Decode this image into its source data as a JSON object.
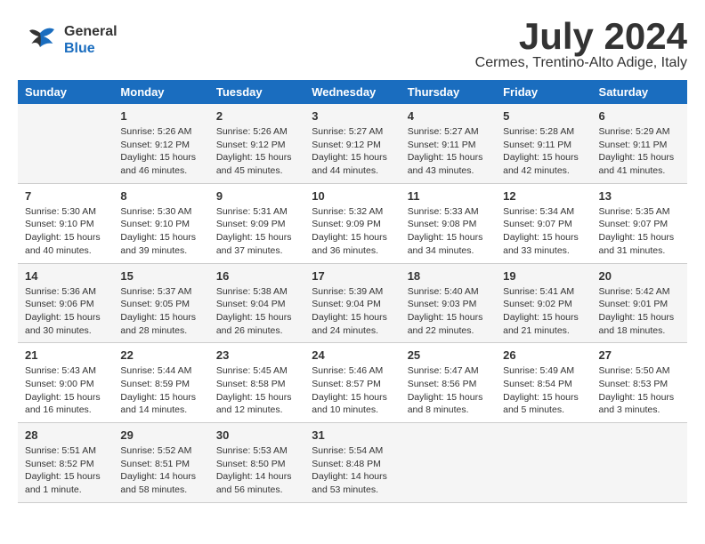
{
  "header": {
    "logo_line1": "General",
    "logo_line2": "Blue",
    "month": "July 2024",
    "location": "Cermes, Trentino-Alto Adige, Italy"
  },
  "weekdays": [
    "Sunday",
    "Monday",
    "Tuesday",
    "Wednesday",
    "Thursday",
    "Friday",
    "Saturday"
  ],
  "weeks": [
    [
      {
        "day": "",
        "info": ""
      },
      {
        "day": "1",
        "info": "Sunrise: 5:26 AM\nSunset: 9:12 PM\nDaylight: 15 hours\nand 46 minutes."
      },
      {
        "day": "2",
        "info": "Sunrise: 5:26 AM\nSunset: 9:12 PM\nDaylight: 15 hours\nand 45 minutes."
      },
      {
        "day": "3",
        "info": "Sunrise: 5:27 AM\nSunset: 9:12 PM\nDaylight: 15 hours\nand 44 minutes."
      },
      {
        "day": "4",
        "info": "Sunrise: 5:27 AM\nSunset: 9:11 PM\nDaylight: 15 hours\nand 43 minutes."
      },
      {
        "day": "5",
        "info": "Sunrise: 5:28 AM\nSunset: 9:11 PM\nDaylight: 15 hours\nand 42 minutes."
      },
      {
        "day": "6",
        "info": "Sunrise: 5:29 AM\nSunset: 9:11 PM\nDaylight: 15 hours\nand 41 minutes."
      }
    ],
    [
      {
        "day": "7",
        "info": "Sunrise: 5:30 AM\nSunset: 9:10 PM\nDaylight: 15 hours\nand 40 minutes."
      },
      {
        "day": "8",
        "info": "Sunrise: 5:30 AM\nSunset: 9:10 PM\nDaylight: 15 hours\nand 39 minutes."
      },
      {
        "day": "9",
        "info": "Sunrise: 5:31 AM\nSunset: 9:09 PM\nDaylight: 15 hours\nand 37 minutes."
      },
      {
        "day": "10",
        "info": "Sunrise: 5:32 AM\nSunset: 9:09 PM\nDaylight: 15 hours\nand 36 minutes."
      },
      {
        "day": "11",
        "info": "Sunrise: 5:33 AM\nSunset: 9:08 PM\nDaylight: 15 hours\nand 34 minutes."
      },
      {
        "day": "12",
        "info": "Sunrise: 5:34 AM\nSunset: 9:07 PM\nDaylight: 15 hours\nand 33 minutes."
      },
      {
        "day": "13",
        "info": "Sunrise: 5:35 AM\nSunset: 9:07 PM\nDaylight: 15 hours\nand 31 minutes."
      }
    ],
    [
      {
        "day": "14",
        "info": "Sunrise: 5:36 AM\nSunset: 9:06 PM\nDaylight: 15 hours\nand 30 minutes."
      },
      {
        "day": "15",
        "info": "Sunrise: 5:37 AM\nSunset: 9:05 PM\nDaylight: 15 hours\nand 28 minutes."
      },
      {
        "day": "16",
        "info": "Sunrise: 5:38 AM\nSunset: 9:04 PM\nDaylight: 15 hours\nand 26 minutes."
      },
      {
        "day": "17",
        "info": "Sunrise: 5:39 AM\nSunset: 9:04 PM\nDaylight: 15 hours\nand 24 minutes."
      },
      {
        "day": "18",
        "info": "Sunrise: 5:40 AM\nSunset: 9:03 PM\nDaylight: 15 hours\nand 22 minutes."
      },
      {
        "day": "19",
        "info": "Sunrise: 5:41 AM\nSunset: 9:02 PM\nDaylight: 15 hours\nand 21 minutes."
      },
      {
        "day": "20",
        "info": "Sunrise: 5:42 AM\nSunset: 9:01 PM\nDaylight: 15 hours\nand 18 minutes."
      }
    ],
    [
      {
        "day": "21",
        "info": "Sunrise: 5:43 AM\nSunset: 9:00 PM\nDaylight: 15 hours\nand 16 minutes."
      },
      {
        "day": "22",
        "info": "Sunrise: 5:44 AM\nSunset: 8:59 PM\nDaylight: 15 hours\nand 14 minutes."
      },
      {
        "day": "23",
        "info": "Sunrise: 5:45 AM\nSunset: 8:58 PM\nDaylight: 15 hours\nand 12 minutes."
      },
      {
        "day": "24",
        "info": "Sunrise: 5:46 AM\nSunset: 8:57 PM\nDaylight: 15 hours\nand 10 minutes."
      },
      {
        "day": "25",
        "info": "Sunrise: 5:47 AM\nSunset: 8:56 PM\nDaylight: 15 hours\nand 8 minutes."
      },
      {
        "day": "26",
        "info": "Sunrise: 5:49 AM\nSunset: 8:54 PM\nDaylight: 15 hours\nand 5 minutes."
      },
      {
        "day": "27",
        "info": "Sunrise: 5:50 AM\nSunset: 8:53 PM\nDaylight: 15 hours\nand 3 minutes."
      }
    ],
    [
      {
        "day": "28",
        "info": "Sunrise: 5:51 AM\nSunset: 8:52 PM\nDaylight: 15 hours\nand 1 minute."
      },
      {
        "day": "29",
        "info": "Sunrise: 5:52 AM\nSunset: 8:51 PM\nDaylight: 14 hours\nand 58 minutes."
      },
      {
        "day": "30",
        "info": "Sunrise: 5:53 AM\nSunset: 8:50 PM\nDaylight: 14 hours\nand 56 minutes."
      },
      {
        "day": "31",
        "info": "Sunrise: 5:54 AM\nSunset: 8:48 PM\nDaylight: 14 hours\nand 53 minutes."
      },
      {
        "day": "",
        "info": ""
      },
      {
        "day": "",
        "info": ""
      },
      {
        "day": "",
        "info": ""
      }
    ]
  ]
}
